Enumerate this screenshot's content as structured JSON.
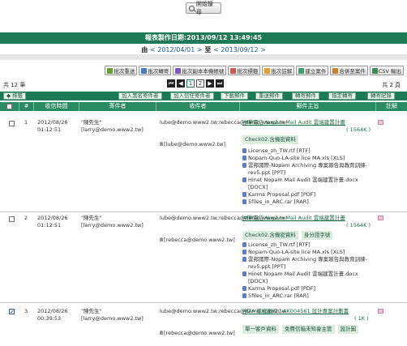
{
  "search_button": {
    "label": "開始搜尋",
    "icon": "search-icon"
  },
  "report": {
    "title": "報表製作日期:2013/09/12 13:49:45",
    "range_from_label": "由",
    "range_from": "< 2012/04/01 >",
    "range_to_label": "至",
    "range_to": "< 2013/09/12 >"
  },
  "toolbar": [
    {
      "label": "批次重送",
      "icon": "resend-icon",
      "color": "#6a9a3a"
    },
    {
      "label": "批次轉寄",
      "icon": "forward-icon",
      "color": "#4a7ab8"
    },
    {
      "label": "批次副本本機帳號",
      "icon": "copy-icon",
      "color": "#7a5ab8"
    },
    {
      "label": "批次標籤",
      "icon": "tag-icon",
      "color": "#c85a5a"
    },
    {
      "label": "批次註解",
      "icon": "note-icon",
      "color": "#d8a23a"
    },
    {
      "label": "建立案件",
      "icon": "case-icon",
      "color": "#4a9a7a"
    },
    {
      "label": "合併至案件",
      "icon": "merge-icon",
      "color": "#c8803a"
    },
    {
      "label": "CSV 輸出",
      "icon": "csv-icon",
      "color": "#3a8a5a"
    }
  ],
  "pagination": {
    "count_label": "共 12 筆",
    "pages": [
      "1",
      "2"
    ],
    "current": "1",
    "total_label": "共 2 頁"
  },
  "actions": {
    "tag_label": "標籤",
    "add_blacklist": "加入黑名寄件者",
    "add_trusted": "加入信任寄件者",
    "download": "下載郵件",
    "resend": "重送郵件",
    "forward": "轉寄郵件",
    "assign_forward": "指定轉寄",
    "forward_records": "轉寄紀錄"
  },
  "columns": {
    "no": "#",
    "time": "收信時間",
    "from": "寄件者",
    "to": "收件者",
    "subject": "郵件主旨",
    "note": "註解"
  },
  "rows": [
    {
      "no": "1",
      "date": "2012/08/26",
      "time": "01:12:51",
      "from": "\"陳先生\" [larry@demo.www2.tw]",
      "to": "lube@demo.www2.tw;rebecca@demo.www2.tw",
      "to_extra": "[lube@demo.www2.tw]",
      "subject": "中華電信 Nopam Mail Audit 雲端建置計畫",
      "size": "( 1564K )",
      "tags": [
        "Check02.含機密資料"
      ],
      "attachments": [
        "License_zh_TW.rtf [RTF]",
        "Nopam-Quo-LA-site lice MA.xls [XLS]",
        "雲邦國際-Nopam Archiving 專案報告與教育訓練-rev5.ppt [PPT]",
        "Hinet Nopam Mail Audit 雲端建置計畫.docx [DOCX]",
        "Karma Proposal.pdf [PDF]",
        "5files_in_ARC.rar [RAR]"
      ],
      "checked": false
    },
    {
      "no": "2",
      "date": "2012/08/26",
      "time": "01:12:51",
      "from": "\"陳先生\" [larry@demo.www2.tw]",
      "to": "lube@demo.www2.tw;rebecca@demo.www2.tw",
      "to_extra": "[rebecca@demo.www2.tw]",
      "subject": "中華電信 Nopam Mail Audit 雲端建置計畫",
      "size": "( 1564K )",
      "tags": [
        "Check02.含機密資料",
        "身分證字號"
      ],
      "attachments": [
        "License_zh_TW.rtf [RTF]",
        "Nopam-Quo-LA-site lice MA.xls [XLS]",
        "雲邦國際-Nopam Archiving 專案報告與教育訓練-rev5.ppt [PPT]",
        "Hinet Nopam Mail Audit 雲端建置計畫.docx [DOCX]",
        "Karma Proposal.pdf [PDF]",
        "5files_in_ARC.rar [RAR]"
      ],
      "checked": false
    },
    {
      "no": "3",
      "date": "2012/08/26",
      "time": "00:39:53",
      "from": "\"陳先生\" [larry@demo.www2.tw]",
      "to": "lube@demo.www2.tw;rebecca@demo.www2.tw",
      "to_extra": "[rebecca@demo.www2.tw]",
      "subject": "中ZA 繼程案BIC-AK004561 設計專案計劃書",
      "size": "( 1K )",
      "tags": [
        "單一客戶資料",
        "免費信箱未知會主管",
        "設計圖"
      ],
      "attachments": [],
      "checked": true
    }
  ],
  "colors": {
    "accent": "#1e7a56",
    "header": "#2a8a62"
  }
}
